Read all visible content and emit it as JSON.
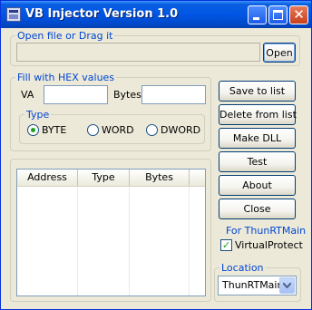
{
  "window": {
    "title": "VB Injector Version 1.0"
  },
  "open_group": {
    "label": "Open file or Drag it",
    "path_value": "",
    "open_button": "Open"
  },
  "hex_group": {
    "label": "Fill with HEX values",
    "va_label": "VA",
    "va_value": "",
    "bytes_label": "Bytes",
    "bytes_value": "",
    "type_group": {
      "label": "Type",
      "options": [
        {
          "label": "BYTE",
          "checked": true
        },
        {
          "label": "WORD",
          "checked": false
        },
        {
          "label": "DWORD",
          "checked": false
        }
      ]
    }
  },
  "list": {
    "columns": [
      "Address",
      "Type",
      "Bytes"
    ],
    "rows": []
  },
  "buttons": {
    "save": "Save to list",
    "delete": "Delete from list",
    "make_dll": "Make DLL",
    "test": "Test",
    "about": "About",
    "close": "Close"
  },
  "thunrt": {
    "label": "For ThunRTMain",
    "virtualprotect_label": "VirtualProtect",
    "virtualprotect_checked": true
  },
  "location": {
    "label": "Location",
    "selected": "ThunRTMain"
  },
  "colors": {
    "accent": "#0046d5",
    "titlebar": "#0055e5",
    "check": "#21a121"
  }
}
